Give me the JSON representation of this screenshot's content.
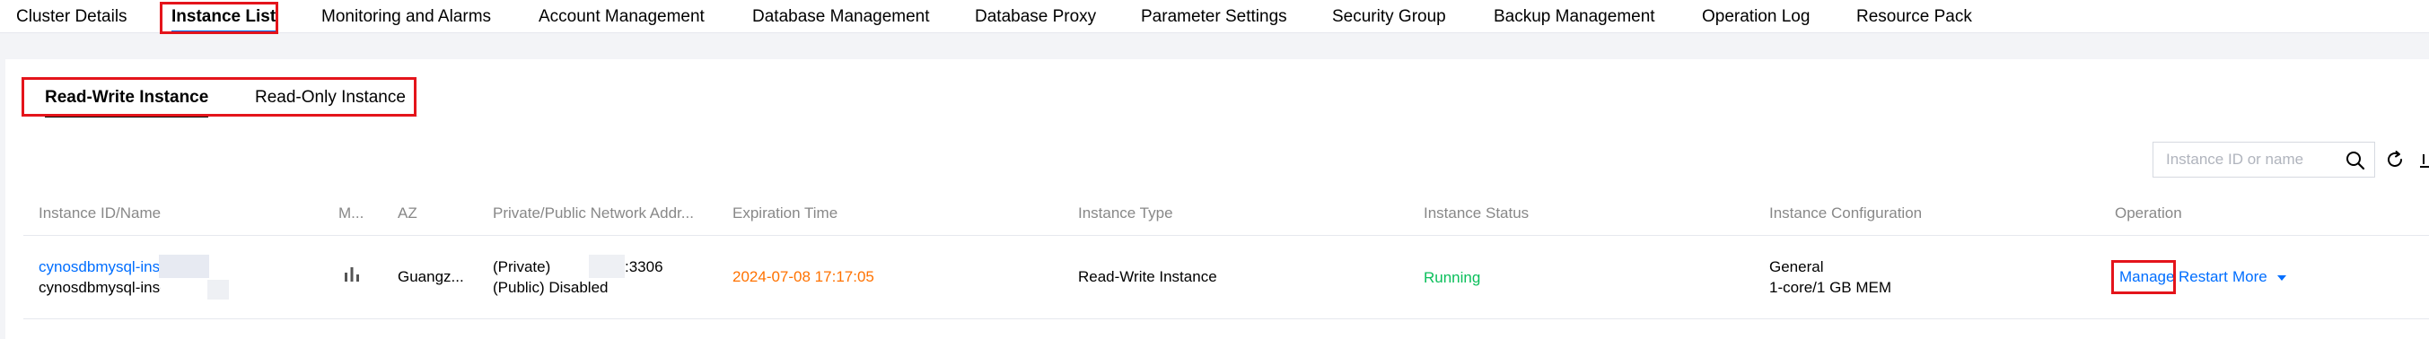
{
  "top_tabs": [
    {
      "label": "Cluster Details"
    },
    {
      "label": "Instance List",
      "active": true
    },
    {
      "label": "Monitoring and Alarms"
    },
    {
      "label": "Account Management"
    },
    {
      "label": "Database Management"
    },
    {
      "label": "Database Proxy"
    },
    {
      "label": "Parameter Settings"
    },
    {
      "label": "Security Group"
    },
    {
      "label": "Backup Management"
    },
    {
      "label": "Operation Log"
    },
    {
      "label": "Resource Pack"
    }
  ],
  "sub_tabs": [
    {
      "label": "Read-Write Instance",
      "active": true
    },
    {
      "label": "Read-Only Instance"
    }
  ],
  "search": {
    "placeholder": "Instance ID or name",
    "value": ""
  },
  "table": {
    "columns": [
      "Instance ID/Name",
      "M...",
      "AZ",
      "Private/Public Network Addr...",
      "Expiration Time",
      "Instance Type",
      "Instance Status",
      "Instance Configuration",
      "Operation"
    ],
    "rows": [
      {
        "instance_id": "cynosdbmysql-ins-",
        "instance_name": "cynosdbmysql-ins-",
        "az": "Guangz...",
        "private_address": "(Private)",
        "private_port": ":3306",
        "public_address": "(Public) Disabled",
        "expiration_time": "2024-07-08 17:17:05",
        "instance_type": "Read-Write Instance",
        "status": "Running",
        "config_line1": "General",
        "config_line2": "1-core/1 GB MEM",
        "operations": {
          "manage": "Manage",
          "restart": "Restart",
          "more": "More"
        }
      }
    ]
  },
  "colors": {
    "accent": "#006eff",
    "highlight": "#e4141b",
    "expiration": "#ff7200",
    "running": "#0abf5b"
  },
  "icons": {
    "search": "search-icon",
    "refresh": "refresh-icon",
    "monitor": "bar-chart-icon",
    "more": "caret-down-icon"
  }
}
